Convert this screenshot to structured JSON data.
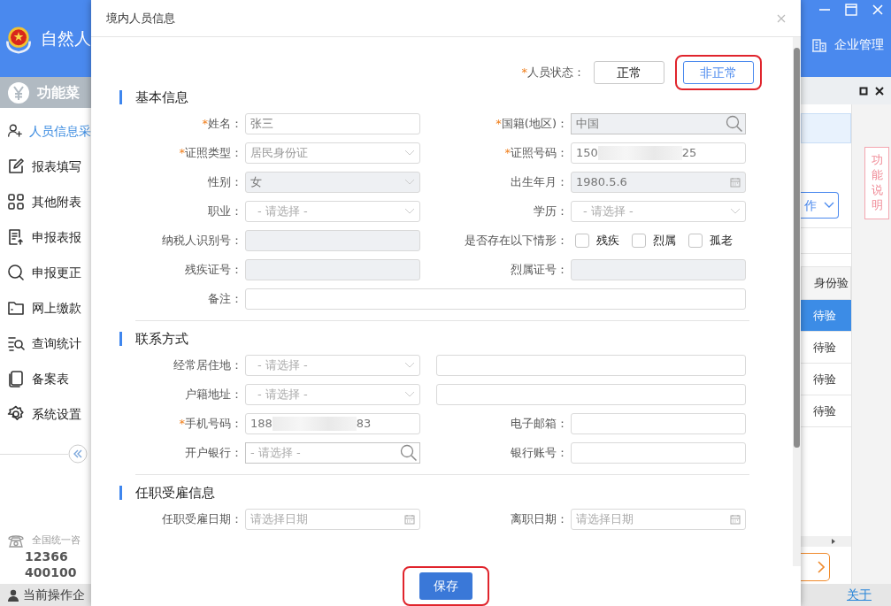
{
  "app_header": {
    "title": "自然人",
    "company_link": "企业管理"
  },
  "side_menu": {
    "title": "功能菜",
    "items": [
      {
        "label": "人员信息采",
        "selected": true
      },
      {
        "label": "报表填写",
        "selected": false
      },
      {
        "label": "其他附表",
        "selected": false
      },
      {
        "label": "申报表报",
        "selected": false
      },
      {
        "label": "申报更正",
        "selected": false
      },
      {
        "label": "网上缴款",
        "selected": false
      },
      {
        "label": "查询统计",
        "selected": false
      },
      {
        "label": "备案表",
        "selected": false
      },
      {
        "label": "系统设置",
        "selected": false
      }
    ]
  },
  "hotline": {
    "caption": "全国统一咨",
    "numbers": [
      "12366",
      "400100"
    ]
  },
  "right_panel": {
    "help_tab": "功能说明",
    "action_button": "作",
    "table_header": "身份验",
    "rows": [
      {
        "status": "待验",
        "selected": true
      },
      {
        "status": "待验",
        "selected": false
      },
      {
        "status": "待验",
        "selected": false
      },
      {
        "status": "待验",
        "selected": false
      }
    ]
  },
  "status_bar": {
    "operator": "当前操作企",
    "about_link": "关于"
  },
  "dialog": {
    "title": "境内人员信息",
    "person_status": {
      "mark": "*",
      "label": "人员状态：",
      "options": [
        {
          "label": "正常",
          "selected": false,
          "highlighted": false
        },
        {
          "label": "非正常",
          "selected": true,
          "highlighted": true
        }
      ]
    },
    "sections": [
      {
        "title": "基本信息",
        "rows": [
          [
            {
              "mark": "*",
              "label": "姓名：",
              "kind": "text",
              "value": "张三",
              "disabled": false
            },
            {
              "mark": "*",
              "label": "国籍(地区)：",
              "kind": "search",
              "value": "中国",
              "disabled": true
            }
          ],
          [
            {
              "mark": "*",
              "label": "证照类型：",
              "kind": "select",
              "value": "居民身份证",
              "disabled": false
            },
            {
              "mark": "*",
              "label": "证照号码：",
              "kind": "text",
              "value": "150",
              "value_end": "25",
              "masked": true,
              "disabled": false
            }
          ],
          [
            {
              "label": "性别：",
              "kind": "select",
              "value": "女",
              "disabled": true
            },
            {
              "label": "出生年月：",
              "kind": "date",
              "value": "1980.5.6",
              "disabled": true
            }
          ],
          [
            {
              "label": "职业：",
              "kind": "select",
              "placeholder": "- 请选择 -",
              "disabled": false
            },
            {
              "label": "学历：",
              "kind": "select",
              "placeholder": "- 请选择 -",
              "disabled": false
            }
          ],
          [
            {
              "label": "纳税人识别号：",
              "kind": "text",
              "disabled": true
            },
            {
              "label": "是否存在以下情形：",
              "kind": "checkboxes",
              "options": [
                {
                  "label": "残疾",
                  "checked": false
                },
                {
                  "label": "烈属",
                  "checked": false
                },
                {
                  "label": "孤老",
                  "checked": false
                }
              ]
            }
          ],
          [
            {
              "label": "残疾证号：",
              "kind": "text",
              "disabled": true
            },
            {
              "label": "烈属证号：",
              "kind": "text",
              "disabled": true
            }
          ],
          [
            {
              "label": "备注：",
              "kind": "text",
              "disabled": false
            }
          ]
        ]
      },
      {
        "title": "联系方式",
        "rows": [
          [
            {
              "label": "经常居住地：",
              "kind": "select",
              "placeholder": "- 请选择 -",
              "disabled": false
            },
            {
              "kind": "text",
              "disabled": false
            }
          ],
          [
            {
              "label": "户籍地址：",
              "kind": "select",
              "placeholder": "- 请选择 -",
              "disabled": false
            },
            {
              "kind": "text",
              "disabled": false
            }
          ],
          [
            {
              "mark": "*",
              "label": "手机号码：",
              "kind": "text",
              "value": "188",
              "value_end": "83",
              "masked": true,
              "disabled": false
            },
            {
              "label": "电子邮箱：",
              "kind": "text",
              "disabled": false
            }
          ],
          [
            {
              "label": "开户银行：",
              "kind": "search",
              "placeholder": "- 请选择 -",
              "disabled": false
            },
            {
              "label": "银行账号：",
              "kind": "text",
              "disabled": false
            }
          ]
        ]
      },
      {
        "title": "任职受雇信息",
        "rows": [
          [
            {
              "label": "任职受雇日期：",
              "kind": "date",
              "placeholder": "请选择日期",
              "disabled": false
            },
            {
              "label": "离职日期：",
              "kind": "date",
              "placeholder": "请选择日期",
              "disabled": false
            }
          ]
        ]
      }
    ],
    "save_button": {
      "label": "保存",
      "highlighted": true
    }
  }
}
